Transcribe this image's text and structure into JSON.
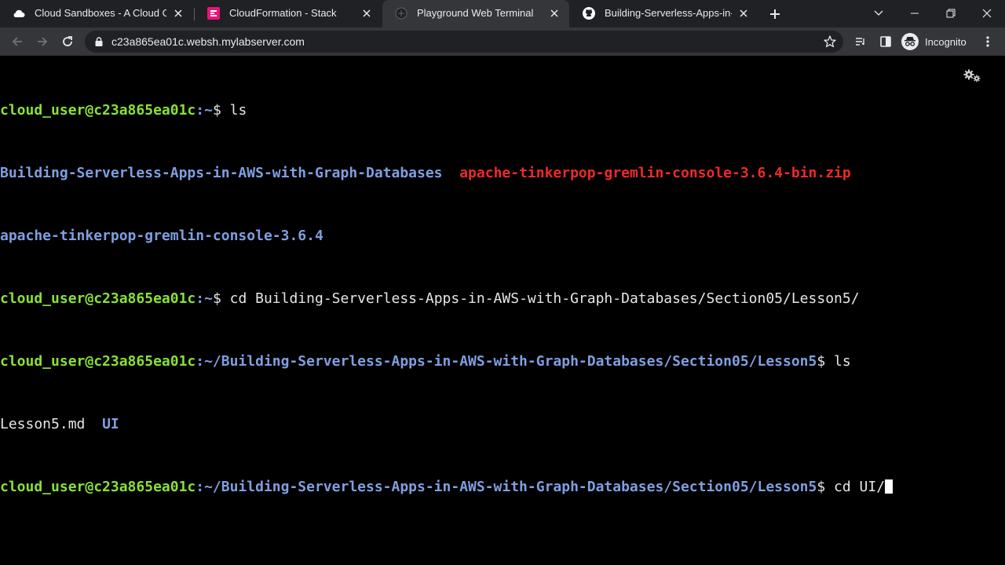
{
  "browser": {
    "tabs": [
      {
        "label": "Cloud Sandboxes - A Cloud Guru",
        "icon": "cloud-icon",
        "active": false
      },
      {
        "label": "CloudFormation - Stack",
        "icon": "cloudformation-icon",
        "active": false
      },
      {
        "label": "Playground Web Terminal",
        "icon": "globe-icon",
        "active": true
      },
      {
        "label": "Building-Serverless-Apps-in-AWS-with-Graph-Databases",
        "icon": "github-icon",
        "active": false
      }
    ],
    "url": "c23a865ea01c.websh.mylabserver.com",
    "profile_label": "Incognito"
  },
  "terminal": {
    "prompt_user_host": "cloud_user@c23a865ea01c",
    "lines": [
      {
        "prompt_user_host": "cloud_user@c23a865ea01c",
        "path": ":~",
        "command": "$ ls"
      },
      {
        "col1": "Building-Serverless-Apps-in-AWS-with-Graph-Databases",
        "col2": "apache-tinkerpop-gremlin-console-3.6.4-bin.zip"
      },
      {
        "col1": "apache-tinkerpop-gremlin-console-3.6.4"
      },
      {
        "prompt_user_host": "cloud_user@c23a865ea01c",
        "path": ":~",
        "command": "$ cd Building-Serverless-Apps-in-AWS-with-Graph-Databases/Section05/Lesson5/"
      },
      {
        "prompt_user_host": "cloud_user@c23a865ea01c",
        "path": ":~/Building-Serverless-Apps-in-AWS-with-Graph-Databases/Section05/Lesson5",
        "command": "$ ls"
      },
      {
        "file": "Lesson5.md",
        "dir": "UI"
      },
      {
        "prompt_user_host": "cloud_user@c23a865ea01c",
        "path": ":~/Building-Serverless-Apps-in-AWS-with-Graph-Databases/Section05/Lesson5",
        "command": "$ cd UI/"
      }
    ]
  },
  "colors": {
    "prompt": "#8ae234",
    "directory": "#7f9fe0",
    "archive": "#ef2929",
    "background": "#000000"
  }
}
